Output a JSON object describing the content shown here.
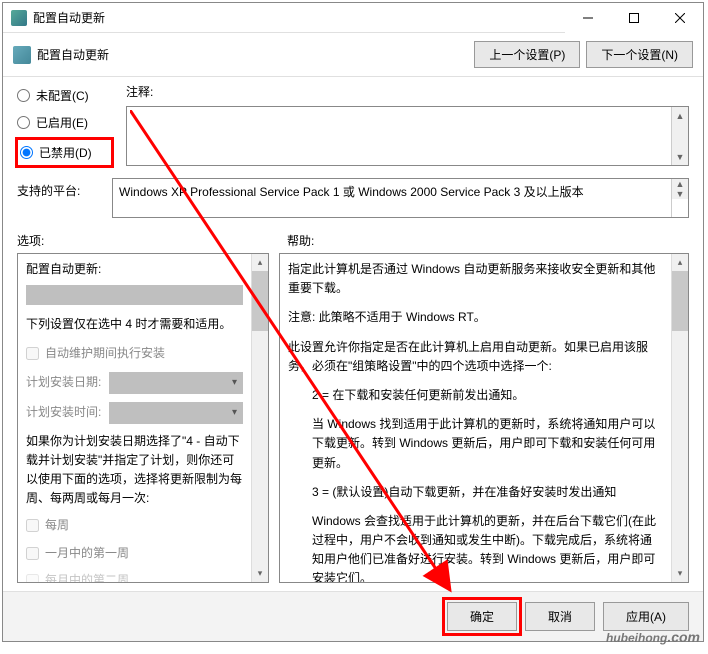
{
  "titlebar": {
    "title": "配置自动更新"
  },
  "subheader": {
    "title": "配置自动更新",
    "prev": "上一个设置(P)",
    "next": "下一个设置(N)"
  },
  "radios": {
    "notConfigured": "未配置(C)",
    "enabled": "已启用(E)",
    "disabled": "已禁用(D)"
  },
  "notesLabel": "注释:",
  "platformLabel": "支持的平台:",
  "platformText": "Windows XP Professional Service Pack 1 或 Windows 2000 Service Pack 3 及以上版本",
  "optionsLabel": "选项:",
  "helpLabel": "帮助:",
  "left": {
    "title": "配置自动更新:",
    "note": "下列设置仅在选中 4 时才需要和适用。",
    "chk1": "自动维护期间执行安装",
    "schedDate": "计划安装日期:",
    "schedTime": "计划安装时间:",
    "para1": "如果你为计划安装日期选择了\"4 - 自动下载并计划安装\"并指定了计划，则你还可以使用下面的选项，选择将更新限制为每周、每两周或每月一次:",
    "chk2": "每周",
    "chk3": "一月中的第一周",
    "chk4": "每月中的第二周"
  },
  "help": {
    "p1": "指定此计算机是否通过 Windows 自动更新服务来接收安全更新和其他重要下载。",
    "p2": "注意: 此策略不适用于 Windows RT。",
    "p3": "此设置允许你指定是否在此计算机上启用自动更新。如果已启用该服务，必须在\"组策略设置\"中的四个选项中选择一个:",
    "p4": "2 = 在下载和安装任何更新前发出通知。",
    "p5": "当 Windows 找到适用于此计算机的更新时，系统将通知用户可以下载更新。转到 Windows 更新后，用户即可下载和安装任何可用更新。",
    "p6": "3 = (默认设置)自动下载更新，并在准备好安装时发出通知",
    "p7": "Windows 会查找适用于此计算机的更新，并在后台下载它们(在此过程中，用户不会收到通知或发生中断)。下载完成后，系统将通知用户他们已准备好进行安装。转到 Windows 更新后，用户即可安装它们。"
  },
  "buttons": {
    "ok": "确定",
    "cancel": "取消",
    "apply": "应用(A)"
  },
  "watermark": {
    "t1": "hubeihong",
    "t2": ".com"
  }
}
